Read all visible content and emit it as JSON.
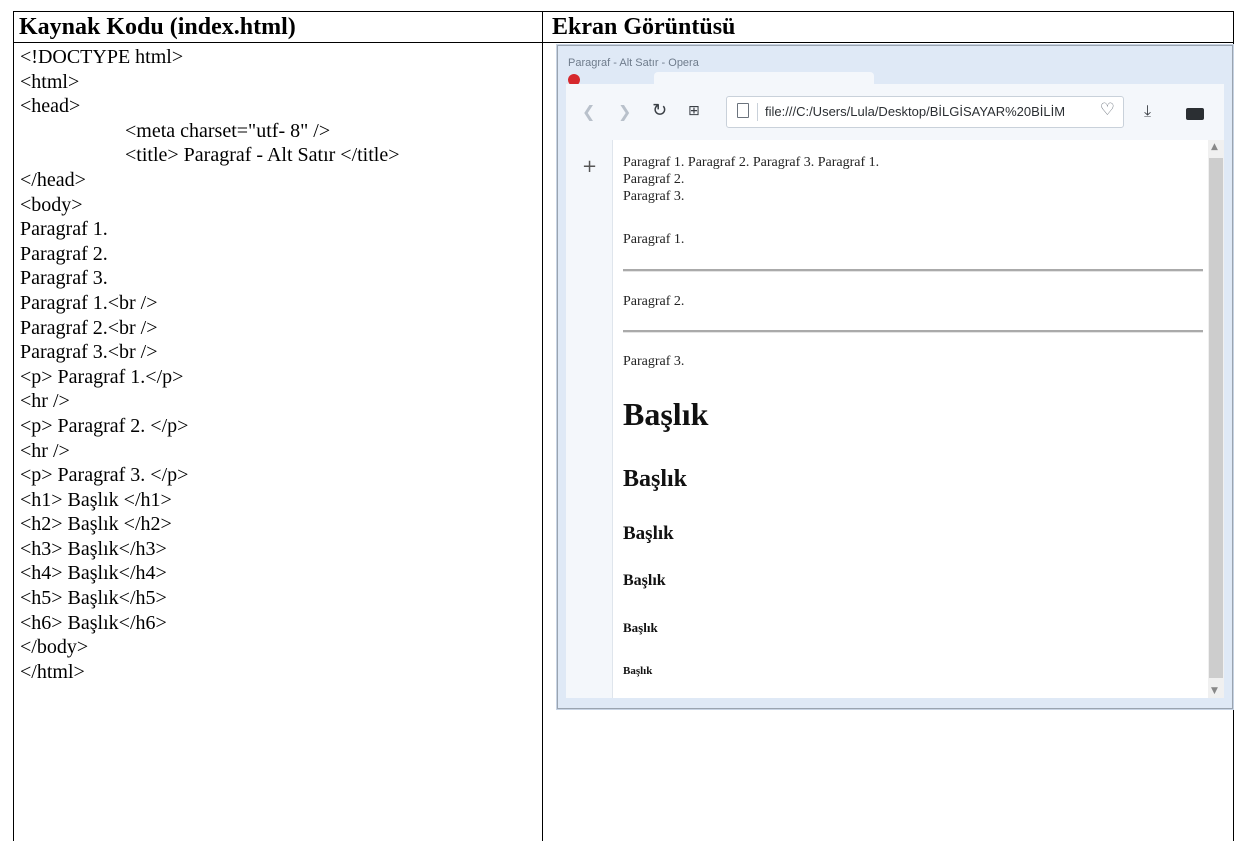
{
  "headers": {
    "left": "Kaynak Kodu (index.html)",
    "right": "Ekran Görüntüsü"
  },
  "code_lines": [
    "<!DOCTYPE html>",
    "<html>",
    "<head>",
    "<meta charset=\"utf- 8\" />",
    "<title> Paragraf - Alt Satır </title>",
    "</head>",
    "<body>",
    "Paragraf 1.",
    "Paragraf 2.",
    "Paragraf 3.",
    "Paragraf 1.<br />",
    "Paragraf 2.<br />",
    "Paragraf 3.<br />",
    "<p> Paragraf 1.</p>",
    "<hr />",
    "<p> Paragraf 2. </p>",
    "<hr />",
    "<p> Paragraf 3. </p>",
    "<h1> Başlık </h1>",
    "<h2> Başlık </h2>",
    "<h3> Başlık</h3>",
    "<h4> Başlık</h4>",
    "<h5> Başlık</h5>",
    "<h6> Başlık</h6>",
    "</body>",
    "</html>"
  ],
  "browser": {
    "window_title": "Paragraf - Alt Satır - Opera",
    "url": "file:///C:/Users/Lula/Desktop/BİLGİSAYAR%20BİLİM",
    "content": {
      "line1": "Paragraf 1. Paragraf 2. Paragraf 3. Paragraf 1.",
      "line2": "Paragraf 2.",
      "line3": "Paragraf 3.",
      "p1": "Paragraf 1.",
      "p2": "Paragraf 2.",
      "p3": "Paragraf 3.",
      "h1": "Başlık",
      "h2": "Başlık",
      "h3": "Başlık",
      "h4": "Başlık",
      "h5": "Başlık",
      "h6": "Başlık"
    },
    "icons": [
      "back-icon",
      "forward-icon",
      "reload-icon",
      "speed-dial-icon",
      "page-icon",
      "heart-icon",
      "download-icon",
      "battery-icon",
      "plus-icon"
    ]
  }
}
